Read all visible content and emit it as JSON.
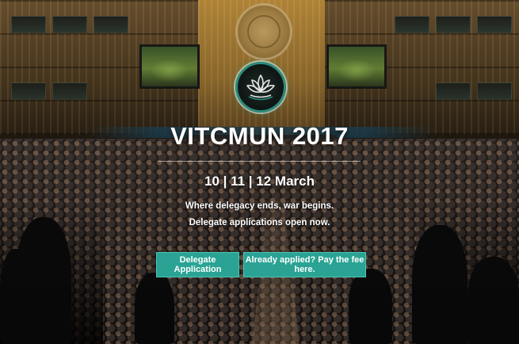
{
  "hero": {
    "title": "VITCMUN 2017",
    "dates": "10 | 11 | 12 March",
    "tagline": "Where delegacy ends, war begins.",
    "notice": "Delegate applications open now."
  },
  "buttons": {
    "delegate_application": "Delegate Application",
    "pay_fee": "Already applied? Pay the fee here."
  },
  "logo": {
    "icon": "lotus-emblem-icon"
  },
  "colors": {
    "accent": "#2aa394",
    "accent_border": "#4cc4b4",
    "logo_ring": "#2b8a7a",
    "text": "#ffffff"
  }
}
